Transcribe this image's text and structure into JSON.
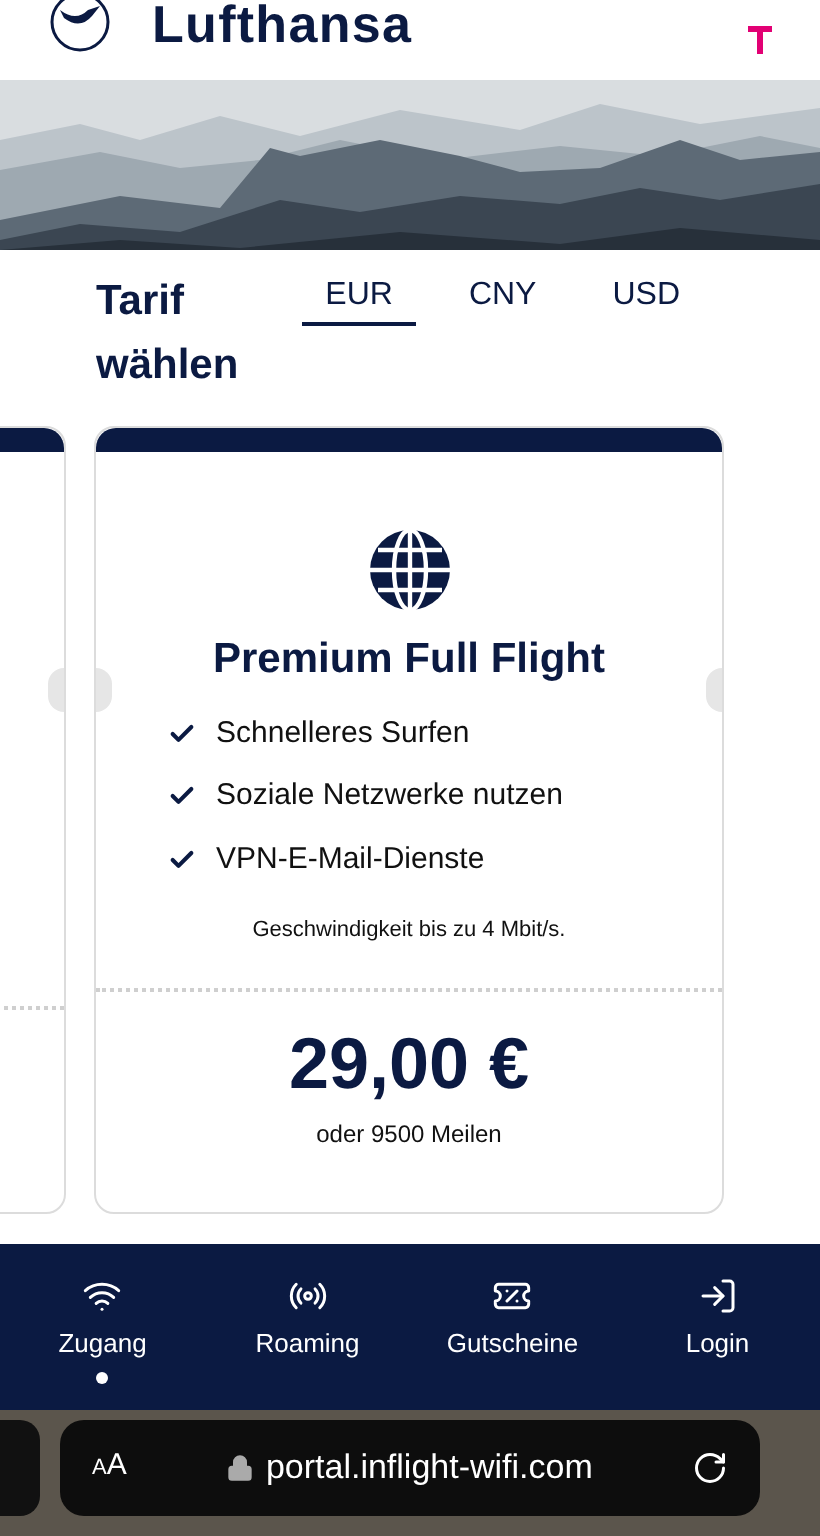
{
  "header": {
    "brand": "Lufthansa"
  },
  "tariff_section": {
    "title": "Tarif wählen",
    "currencies": [
      {
        "label": "EUR",
        "selected": true
      },
      {
        "label": "CNY",
        "selected": false
      },
      {
        "label": "USD",
        "selected": false
      }
    ]
  },
  "card": {
    "title": "Premium Full Flight",
    "features": [
      "Schnelleres Surfen",
      "Soziale Netzwerke nutzen",
      "VPN-E-Mail-Dienste"
    ],
    "speed_note": "Geschwindigkeit bis zu 4 Mbit/s.",
    "price": "29,00 €",
    "miles": "oder 9500 Meilen"
  },
  "bottom_nav": [
    {
      "label": "Zugang",
      "selected": true
    },
    {
      "label": "Roaming",
      "selected": false
    },
    {
      "label": "Gutscheine",
      "selected": false
    },
    {
      "label": "Login",
      "selected": false
    }
  ],
  "browser_bar": {
    "text_size_button": "AA",
    "url": "portal.inflight-wifi.com"
  }
}
